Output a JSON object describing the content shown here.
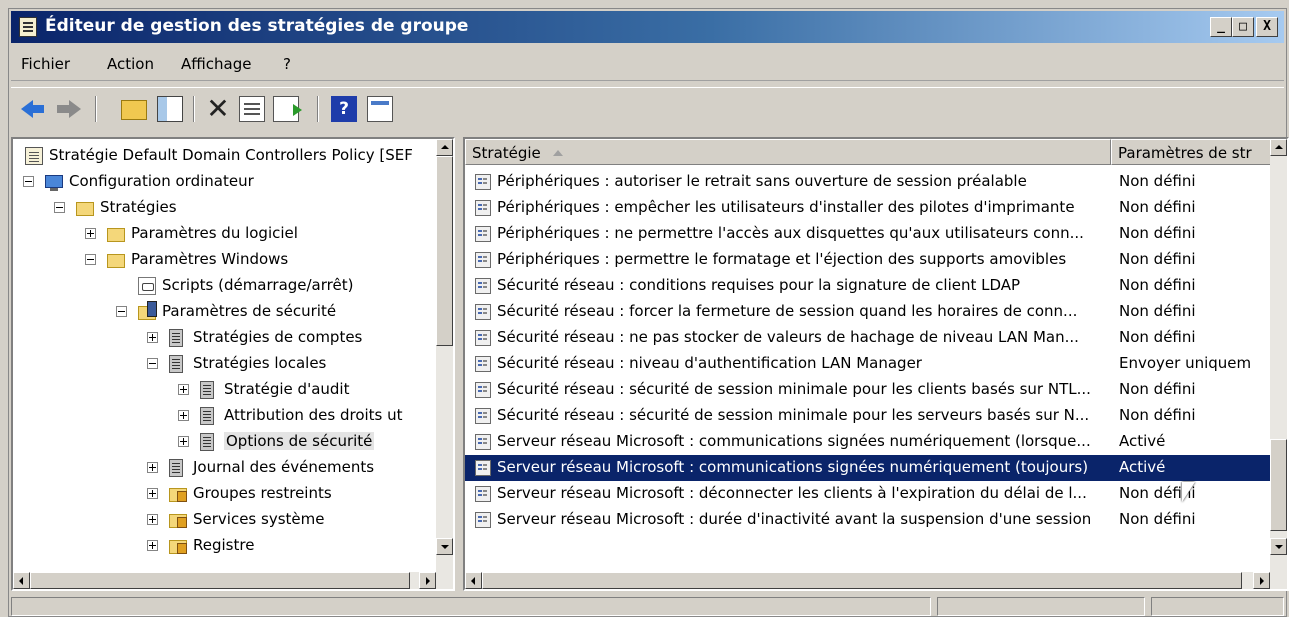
{
  "window": {
    "title": "Éditeur de gestion des stratégies de groupe",
    "min": "_",
    "max": "□",
    "close": "X"
  },
  "menu": [
    "Fichier",
    "Action",
    "Affichage",
    "?"
  ],
  "toolbar": {
    "help": "?"
  },
  "tree": [
    {
      "label": "Stratégie Default Domain Controllers Policy [SEF",
      "icon": "policy-doc-icon",
      "level": 0
    },
    {
      "label": "Configuration ordinateur",
      "icon": "computer-icon",
      "level": 0,
      "expander": "minus"
    },
    {
      "label": "Stratégies",
      "icon": "folder-icon",
      "level": 1,
      "expander": "minus"
    },
    {
      "label": "Paramètres du logiciel",
      "icon": "folder-icon",
      "level": 2,
      "expander": "plus"
    },
    {
      "label": "Paramètres Windows",
      "icon": "folder-icon",
      "level": 2,
      "expander": "minus"
    },
    {
      "label": "Scripts (démarrage/arrêt)",
      "icon": "scripts-icon",
      "level": 3
    },
    {
      "label": "Paramètres de sécurité",
      "icon": "security-folder-icon",
      "level": 3,
      "expander": "minus"
    },
    {
      "label": "Stratégies de comptes",
      "icon": "server-icon",
      "level": 4,
      "expander": "plus"
    },
    {
      "label": "Stratégies locales",
      "icon": "server-icon",
      "level": 4,
      "expander": "minus"
    },
    {
      "label": "Stratégie d'audit",
      "icon": "server-icon",
      "level": 5,
      "expander": "plus"
    },
    {
      "label": "Attribution des droits ut",
      "icon": "server-icon",
      "level": 5,
      "expander": "plus"
    },
    {
      "label": "Options de sécurité",
      "icon": "server-icon",
      "level": 5,
      "expander": "plus",
      "selected": true
    },
    {
      "label": "Journal des événements",
      "icon": "server-icon",
      "level": 4,
      "expander": "plus"
    },
    {
      "label": "Groupes restreints",
      "icon": "lock-folder-icon",
      "level": 4,
      "expander": "plus"
    },
    {
      "label": "Services système",
      "icon": "lock-folder-icon",
      "level": 4,
      "expander": "plus"
    },
    {
      "label": "Registre",
      "icon": "lock-folder-icon",
      "level": 4,
      "expander": "plus"
    }
  ],
  "list": {
    "columns": [
      "Stratégie",
      "Paramètres de str"
    ],
    "rows": [
      {
        "name": "Périphériques : autoriser le retrait sans ouverture de session préalable",
        "value": "Non défini"
      },
      {
        "name": "Périphériques : empêcher les utilisateurs d'installer des pilotes d'imprimante",
        "value": "Non défini"
      },
      {
        "name": "Périphériques : ne permettre l'accès aux disquettes qu'aux utilisateurs conn...",
        "value": "Non défini"
      },
      {
        "name": "Périphériques : permettre le formatage et l'éjection des supports amovibles",
        "value": "Non défini"
      },
      {
        "name": "Sécurité réseau : conditions requises pour la signature de client LDAP",
        "value": "Non défini"
      },
      {
        "name": "Sécurité réseau : forcer la fermeture de session quand les horaires de conn...",
        "value": "Non défini"
      },
      {
        "name": "Sécurité réseau : ne pas stocker de valeurs de hachage de niveau LAN Man...",
        "value": "Non défini"
      },
      {
        "name": "Sécurité réseau : niveau d'authentification LAN Manager",
        "value": "Envoyer uniquem"
      },
      {
        "name": "Sécurité réseau : sécurité de session minimale pour les clients basés sur NTL...",
        "value": "Non défini"
      },
      {
        "name": "Sécurité réseau : sécurité de session minimale pour les serveurs basés sur N...",
        "value": "Non défini"
      },
      {
        "name": "Serveur réseau Microsoft : communications signées numériquement (lorsque...",
        "value": "Activé"
      },
      {
        "name": "Serveur réseau Microsoft : communications signées numériquement (toujours)",
        "value": "Activé",
        "selected": true
      },
      {
        "name": "Serveur réseau Microsoft : déconnecter les clients à l'expiration du délai de l...",
        "value": "Non défini"
      },
      {
        "name": "Serveur réseau Microsoft : durée d'inactivité avant la suspension d'une session",
        "value": "Non défini"
      }
    ]
  },
  "colors": {
    "title_start": "#0a246a",
    "title_end": "#a6caf0",
    "selection": "#0a246a"
  }
}
